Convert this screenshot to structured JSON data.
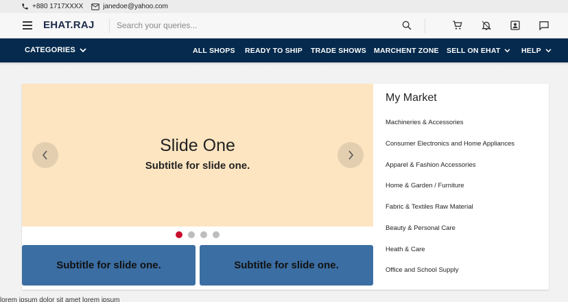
{
  "topbar": {
    "phone": "+880 1717XXXX",
    "email": "janedoe@yahoo.com"
  },
  "header": {
    "logo": "EHAT.RAJ",
    "search_placeholder": "Search your queries...",
    "icons": [
      "menu-icon",
      "search-icon",
      "cart-icon",
      "bell-icon",
      "account-icon",
      "chat-icon"
    ]
  },
  "nav": {
    "categories": "CATEGORIES",
    "links": [
      "ALL SHOPS",
      "READY TO SHIP",
      "TRADE SHOWS",
      "MARCHENT ZONE",
      "SELL ON EHAT",
      "HELP"
    ]
  },
  "slider": {
    "title": "Slide One",
    "subtitle": "Subtitle for slide one.",
    "dot_count": 4,
    "active_index": 0,
    "accent_color": "#c8102e",
    "background": "#fde5c1"
  },
  "promos": [
    "Subtitle for slide one.",
    "Subtitle for slide one."
  ],
  "market": {
    "title": "My Market",
    "items": [
      "Machineries & Accessories",
      "Consumer Electronics and Home Appliances",
      "Apparel & Fashion Accessories",
      "Home & Garden / Furniture",
      "Fabric & Textiles Raw Material",
      "Beauty & Personal Care",
      "Heath & Care",
      "Office and School Supply"
    ]
  },
  "colors": {
    "nav_bg": "#052a4d",
    "promo_bg": "#3b6ea3"
  },
  "bottom_text": "lorem ipsum dolor sit amet lorem ipsum"
}
